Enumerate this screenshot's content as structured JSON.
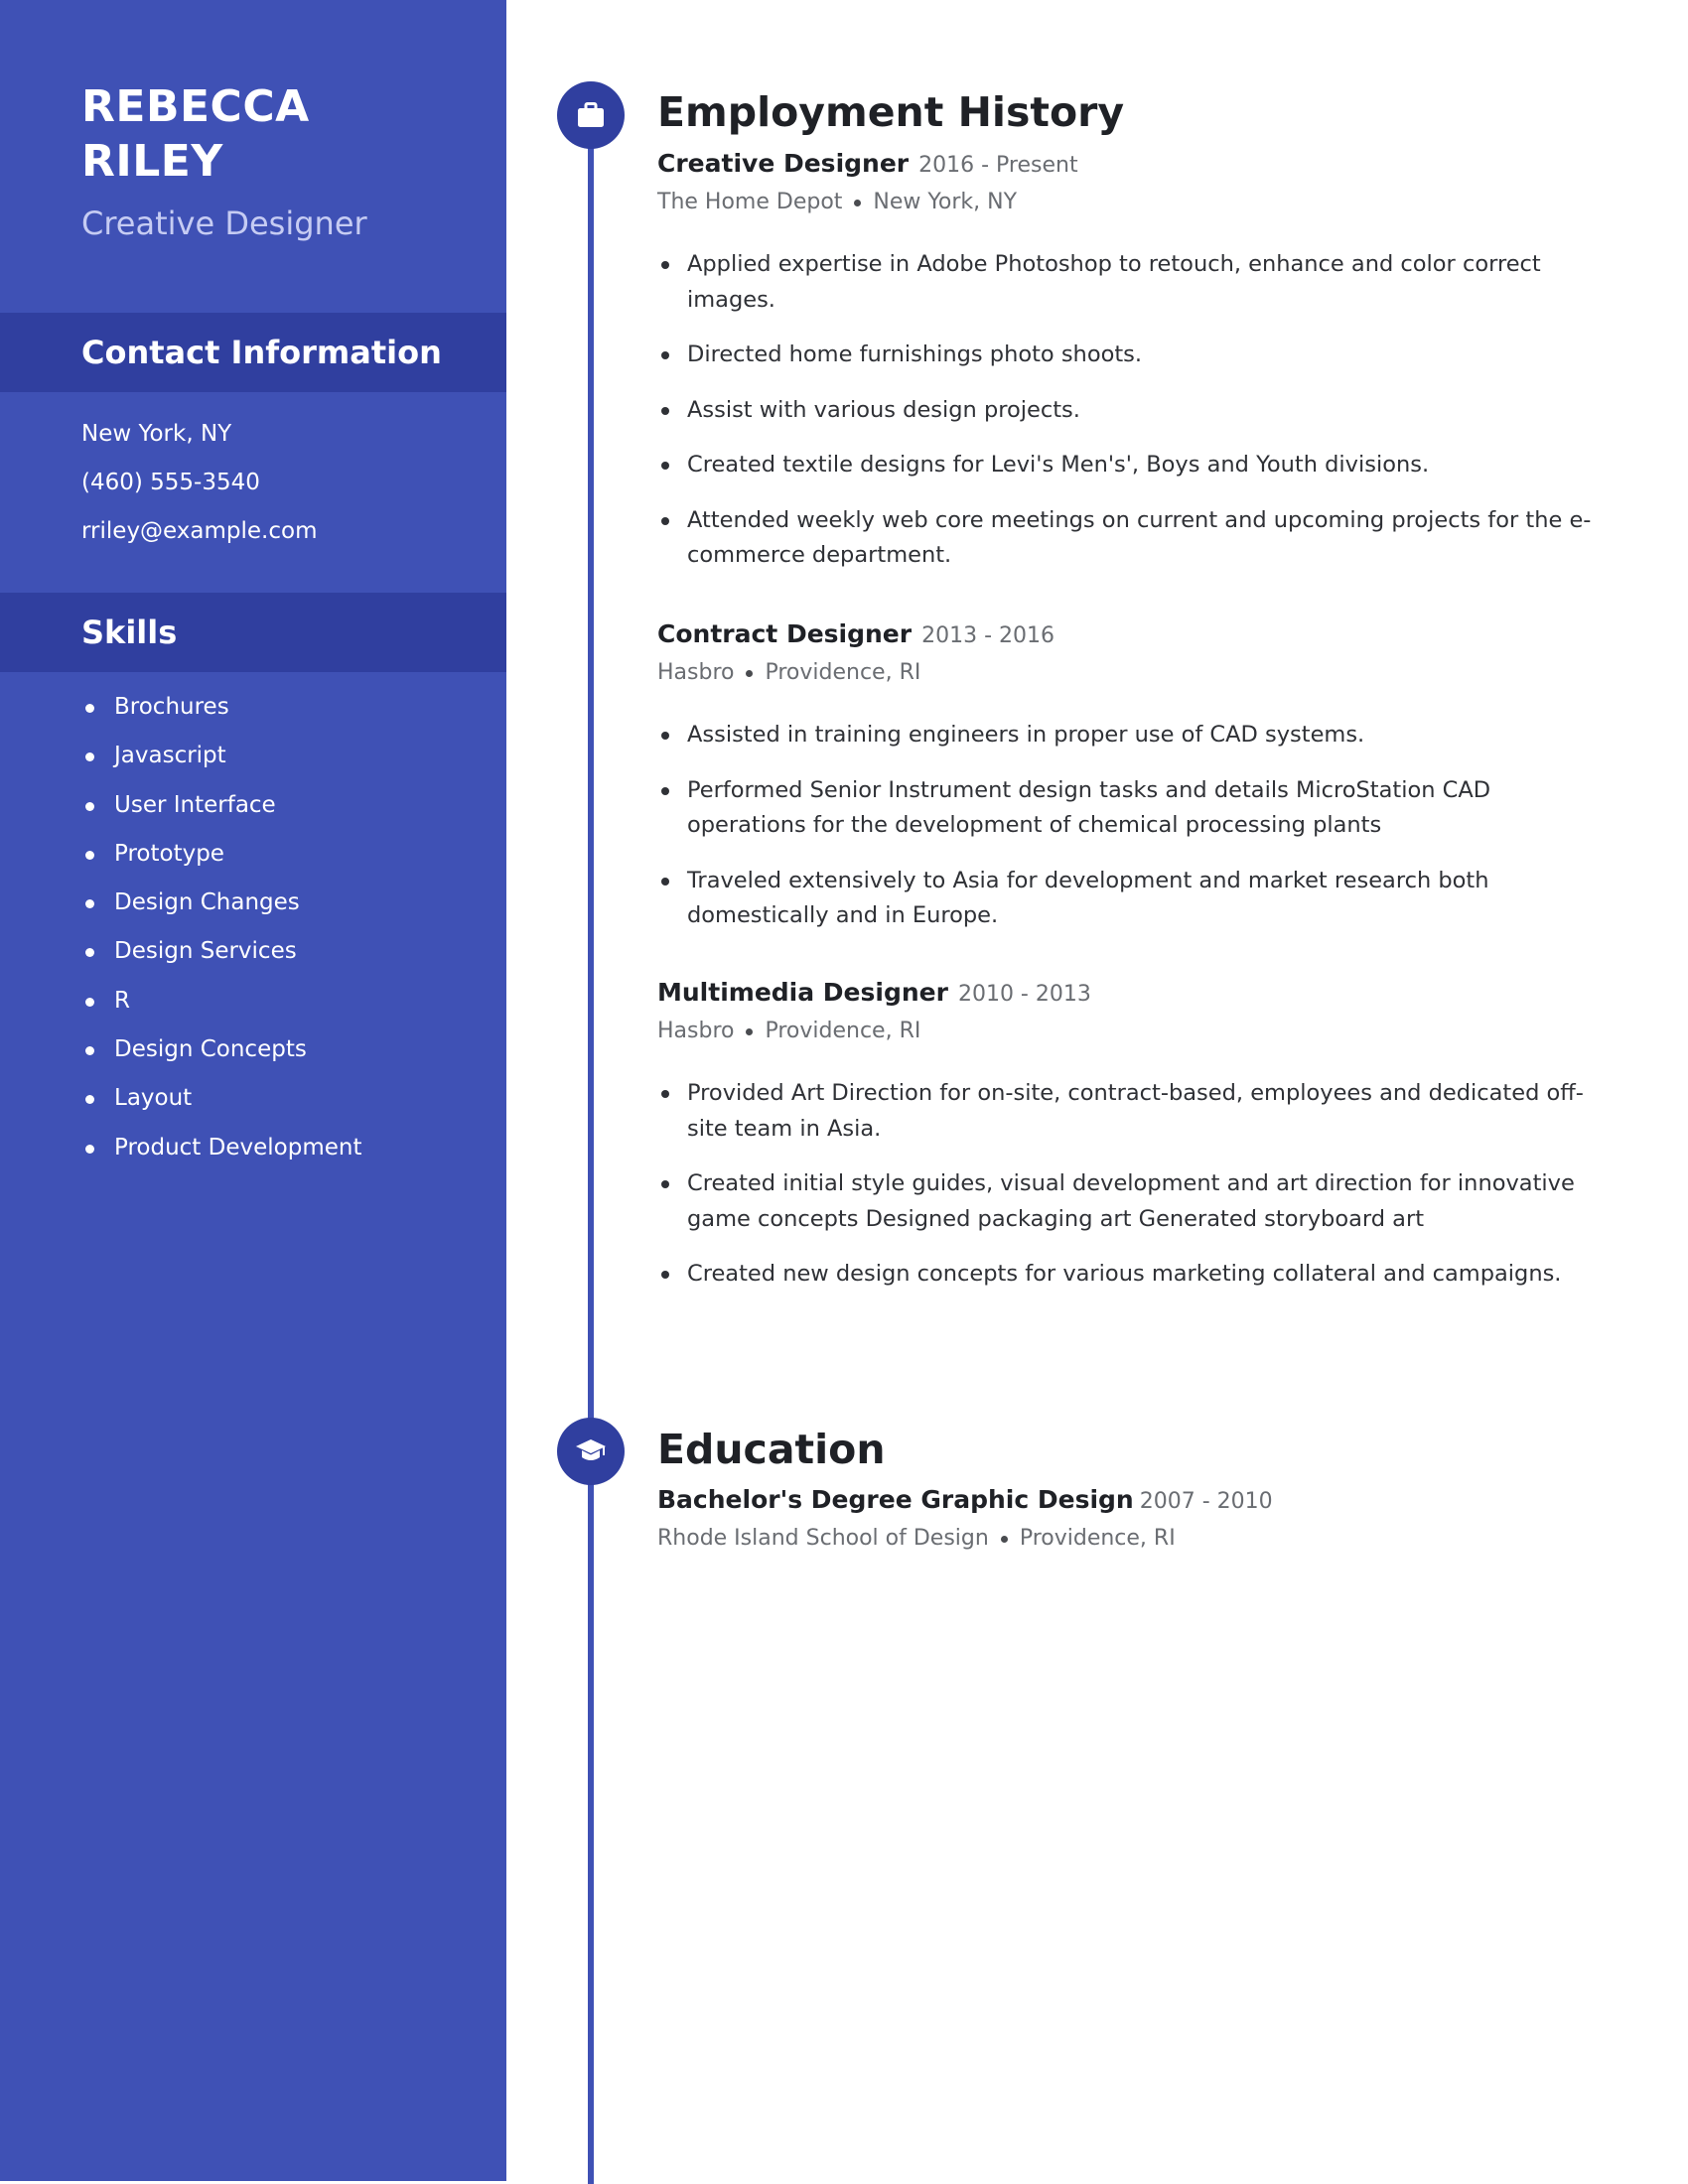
{
  "sidebar": {
    "name_line1": "REBECCA",
    "name_line2": "RILEY",
    "role": "Creative Designer",
    "contact": {
      "heading": "Contact Information",
      "items": [
        "New York, NY",
        "(460) 555-3540",
        "rriley@example.com"
      ]
    },
    "skills": {
      "heading": "Skills",
      "items": [
        "Brochures",
        "Javascript",
        "User Interface",
        "Prototype",
        "Design Changes",
        "Design Services",
        "R",
        "Design Concepts",
        "Layout",
        "Product Development"
      ]
    }
  },
  "employment": {
    "heading": "Employment History",
    "icon": "briefcase-icon",
    "jobs": [
      {
        "title": "Creative Designer",
        "dates": "2016 - Present",
        "company": "The Home Depot",
        "location": "New York, NY",
        "bullets": [
          "Applied expertise in Adobe Photoshop to retouch, enhance and color correct images.",
          "Directed home furnishings photo shoots.",
          "Assist with various design projects.",
          "Created textile designs for Levi's Men's', Boys and Youth divisions.",
          "Attended weekly web core meetings on current and upcoming projects for the e-commerce department."
        ]
      },
      {
        "title": "Contract Designer",
        "dates": "2013 - 2016",
        "company": "Hasbro",
        "location": "Providence, RI",
        "bullets": [
          "Assisted in training engineers in proper use of CAD systems.",
          "Performed Senior Instrument design tasks and details MicroStation CAD operations for the development of chemical processing plants",
          "Traveled extensively to Asia for development and market research both domestically and in Europe."
        ]
      },
      {
        "title": "Multimedia Designer",
        "dates": "2010 - 2013",
        "company": "Hasbro",
        "location": "Providence, RI",
        "bullets": [
          "Provided Art Direction for on-site, contract-based, employees and dedicated off-site team in Asia.",
          "Created initial style guides, visual development and art direction for innovative game concepts Designed packaging art Generated storyboard art",
          "Created new design concepts for various marketing collateral and campaigns."
        ]
      }
    ]
  },
  "education": {
    "heading": "Education",
    "icon": "graduation-cap-icon",
    "entries": [
      {
        "degree": "Bachelor's Degree Graphic Design",
        "dates": "2007 - 2010",
        "school": "Rhode Island School of Design",
        "location": "Providence, RI"
      }
    ]
  },
  "colors": {
    "sidebar": "#3f51b5",
    "sidebar_band": "#303f9f",
    "accent": "#3f51b5",
    "role_text": "#c6ccf3",
    "heading_text": "#1f2126",
    "muted_text": "#6a6d72"
  }
}
